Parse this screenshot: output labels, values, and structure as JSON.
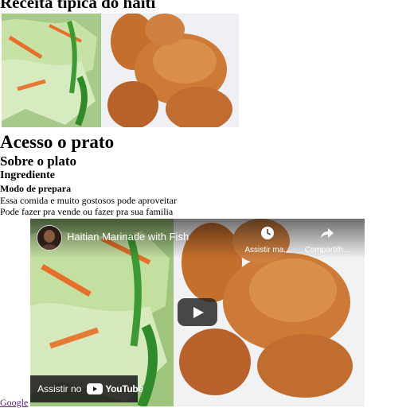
{
  "page": {
    "title": "Receita típica do haiti",
    "heading_1": "Acesso o prato",
    "heading_2": "Sobre o plato",
    "heading_3": "Ingrediente",
    "heading_4": "Modo de prepara",
    "paragraph_1": "Essa comida e muito gostosos pode aproveitar",
    "paragraph_2": "Pode fazer pra vende ou fazer pra sua familia",
    "link_text": "Google"
  },
  "video": {
    "title": "Haitian Marinade with Fish",
    "watch_later_label": "Assistir ma...",
    "share_label": "Compartilh...",
    "watch_on_label": "Assistir no",
    "youtube_wordmark": "YouTube"
  },
  "icons": {
    "watch_later": "clock-icon",
    "share": "share-arrow-icon",
    "play": "play-icon",
    "youtube": "youtube-logo-icon"
  },
  "colors": {
    "youtube_red": "#ff0000",
    "link": "#551a8b",
    "overlay": "#212121"
  }
}
